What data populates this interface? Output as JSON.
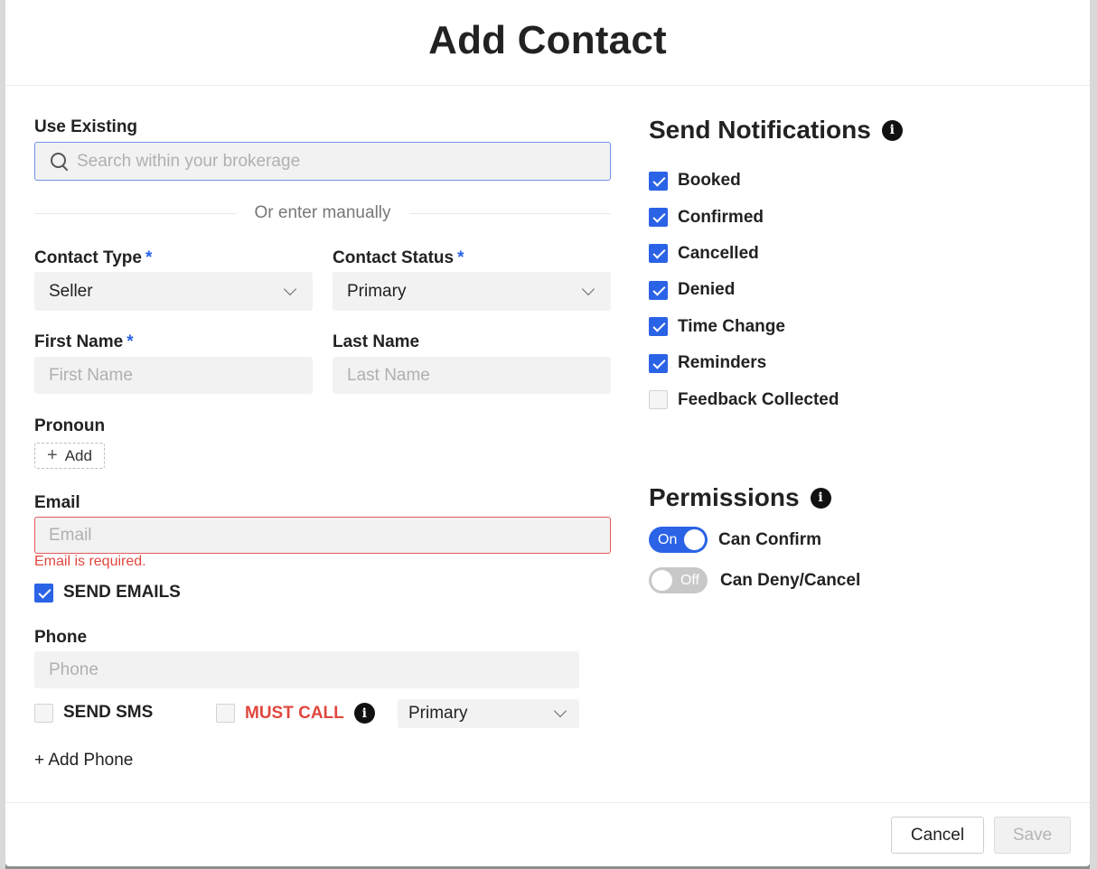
{
  "modal": {
    "title": "Add Contact"
  },
  "use_existing": {
    "label": "Use Existing",
    "search_placeholder": "Search within your brokerage"
  },
  "divider_text": "Or enter manually",
  "contact_type": {
    "label": "Contact Type",
    "required_mark": "*",
    "value": "Seller"
  },
  "contact_status": {
    "label": "Contact Status",
    "required_mark": "*",
    "value": "Primary"
  },
  "first_name": {
    "label": "First Name",
    "required_mark": "*",
    "placeholder": "First Name",
    "value": ""
  },
  "last_name": {
    "label": "Last Name",
    "placeholder": "Last Name",
    "value": ""
  },
  "pronoun": {
    "label": "Pronoun",
    "add_label": "Add"
  },
  "email": {
    "label": "Email",
    "placeholder": "Email",
    "value": "",
    "error": "Email is required.",
    "send_emails_label": "SEND EMAILS",
    "send_emails_checked": true
  },
  "phone": {
    "label": "Phone",
    "placeholder": "Phone",
    "value": "",
    "send_sms_label": "SEND SMS",
    "send_sms_checked": false,
    "must_call_label": "MUST CALL",
    "must_call_checked": false,
    "type_value": "Primary",
    "add_phone_label": "+ Add Phone"
  },
  "notifications": {
    "title": "Send Notifications",
    "items": [
      {
        "label": "Booked",
        "checked": true
      },
      {
        "label": "Confirmed",
        "checked": true
      },
      {
        "label": "Cancelled",
        "checked": true
      },
      {
        "label": "Denied",
        "checked": true
      },
      {
        "label": "Time Change",
        "checked": true
      },
      {
        "label": "Reminders",
        "checked": true
      },
      {
        "label": "Feedback Collected",
        "checked": false
      }
    ]
  },
  "permissions": {
    "title": "Permissions",
    "items": [
      {
        "label": "Can Confirm",
        "state": "On",
        "on": true
      },
      {
        "label": "Can Deny/Cancel",
        "state": "Off",
        "on": false
      }
    ]
  },
  "footer": {
    "cancel_label": "Cancel",
    "save_label": "Save"
  },
  "colors": {
    "accent": "#2b63e6",
    "error": "#e0473f",
    "backdrop": "#8f8f8f"
  },
  "icons": {
    "info": "info-icon",
    "search": "search-icon",
    "chevron": "chevron-down-icon",
    "plus": "plus-icon",
    "check": "checkmark-icon"
  }
}
